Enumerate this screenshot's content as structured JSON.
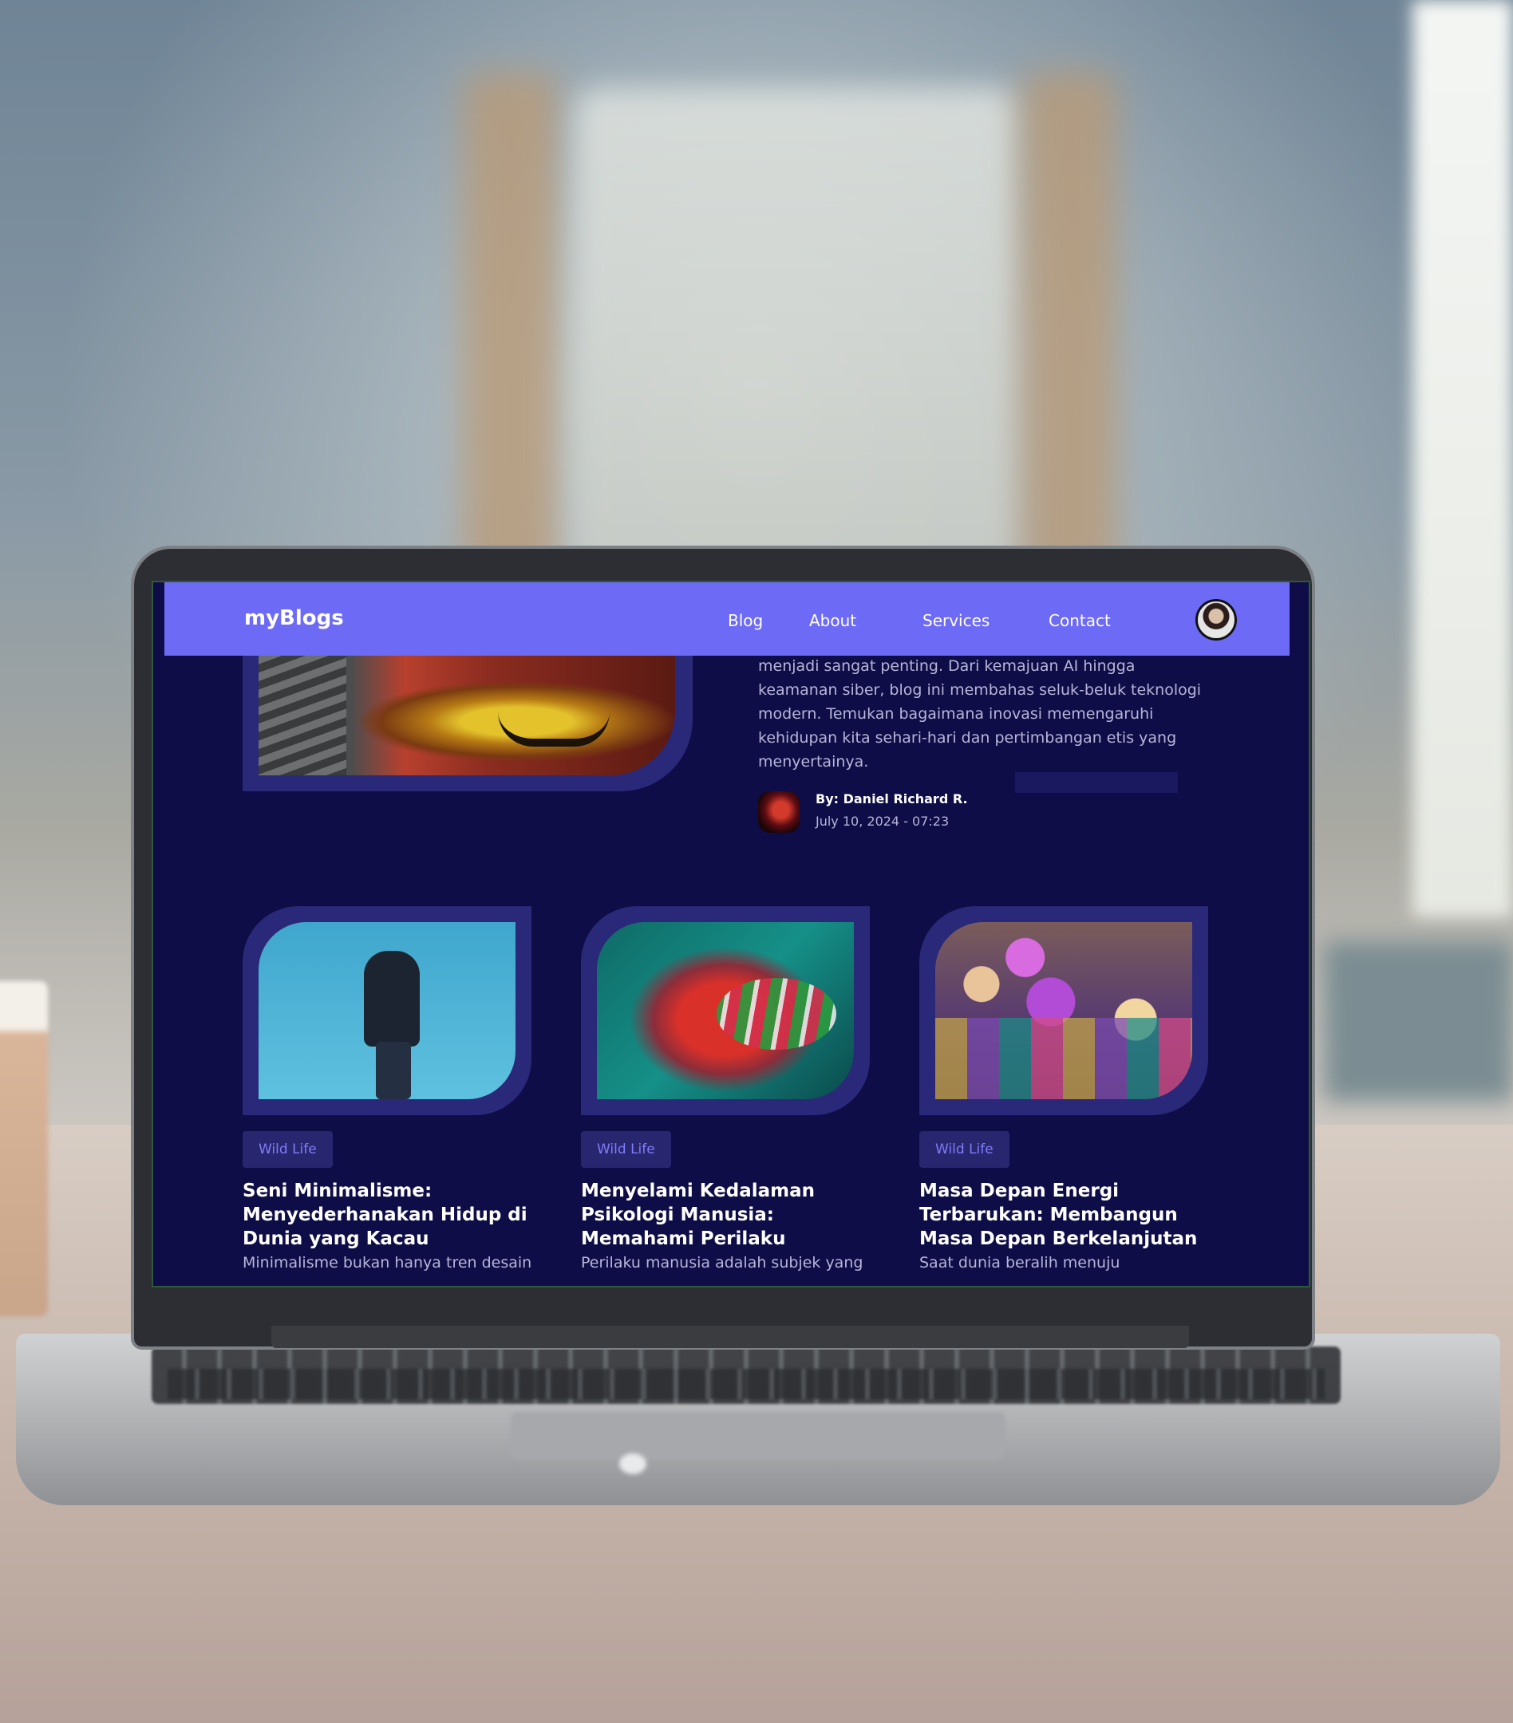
{
  "nav": {
    "logo": "myBlogs",
    "links": [
      "Blog",
      "About",
      "Services",
      "Contact"
    ]
  },
  "featured": {
    "excerpt": "menjadi sangat penting. Dari kemajuan AI hingga keamanan siber, blog ini membahas seluk-beluk teknologi modern. Temukan bagaimana inovasi memengaruhi kehidupan kita sehari-hari dan pertimbangan etis yang menyertainya.",
    "author": "By: Daniel Richard R.",
    "date": "July 10, 2024 - 07:23"
  },
  "cards": [
    {
      "tag": "Wild Life",
      "title": "Seni Minimalisme: Menyederhanakan Hidup di Dunia yang Kacau",
      "excerpt": "Minimalisme bukan hanya tren desain;"
    },
    {
      "tag": "Wild Life",
      "title": "Menyelami Kedalaman Psikologi Manusia: Memahami Perilaku",
      "excerpt": "Perilaku manusia adalah subjek yang"
    },
    {
      "tag": "Wild Life",
      "title": "Masa Depan Energi Terbarukan: Membangun Masa Depan Berkelanjutan",
      "excerpt": "Saat dunia beralih menuju"
    }
  ],
  "colors": {
    "nav_bg": "#6d6af5",
    "page_bg": "#0e0d47",
    "card_frame": "#2a2878",
    "tag_text": "#7f7cf8"
  },
  "icons": {
    "profile": "user-avatar",
    "author": "author-avatar"
  }
}
